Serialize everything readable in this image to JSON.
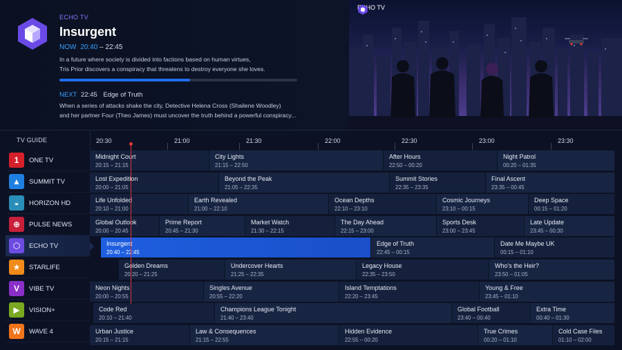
{
  "info": {
    "channel": "ECHO TV",
    "title": "Insurgent",
    "now_label": "NOW",
    "now_start": "20:40",
    "now_end": "– 22:45",
    "description_1": "In a future where society is divided into factions based on human virtues,",
    "description_2": "Tris Prior discovers a conspiracy that threatens to destroy everyone she loves.",
    "progress": 0.55,
    "next_label": "NEXT",
    "next_time": "22:45",
    "next_title": "Edge of Truth",
    "next_desc_1": "When a series of attacks shake the city, Detective Helena Cross (Shailene Woodley)",
    "next_desc_2": "and her partner Four (Theo James) must uncover the truth behind a powerful conspiracy..."
  },
  "preview": {
    "badge": "ECHO TV"
  },
  "guide": {
    "label": "TV GUIDE",
    "times": [
      "20:30",
      "21:00",
      "21:30",
      "22:00",
      "22:30",
      "23:00",
      "23:30"
    ],
    "channels": [
      {
        "name": "ONE TV",
        "glyph": "1",
        "color": "#d4202a"
      },
      {
        "name": "SUMMIT TV",
        "glyph": "▲",
        "color": "#1e7fe0"
      },
      {
        "name": "HORIZON HD",
        "glyph": "◒",
        "color": "#2a8fb8"
      },
      {
        "name": "PULSE NEWS",
        "glyph": "⊕",
        "color": "#c8203a"
      },
      {
        "name": "ECHO TV",
        "glyph": "⬡",
        "color": "#6b4be0"
      },
      {
        "name": "STARLIFE",
        "glyph": "★",
        "color": "#f08a1a"
      },
      {
        "name": "VIBE TV",
        "glyph": "V",
        "color": "#8a2fc8"
      },
      {
        "name": "VISION+",
        "glyph": "▶",
        "color": "#7aa820"
      },
      {
        "name": "WAVE 4",
        "glyph": "W",
        "color": "#f0741a"
      }
    ],
    "rows": [
      [
        {
          "title": "Midnight Court",
          "time": "20:15 – 21:15",
          "s": 0,
          "e": 173
        },
        {
          "title": "City Lights",
          "time": "21:15 – 22:50",
          "s": 173,
          "e": 425
        },
        {
          "title": "After Hours",
          "time": "22:50 – 00:20",
          "s": 425,
          "e": 590
        },
        {
          "title": "Night Patrol",
          "time": "00:20 – 01:35",
          "s": 590,
          "e": 760
        }
      ],
      [
        {
          "title": "Lost Expedition",
          "time": "20:00 – 21:05",
          "s": 0,
          "e": 187
        },
        {
          "title": "Beyond the Peak",
          "time": "21:05 – 22:35",
          "s": 187,
          "e": 434
        },
        {
          "title": "Summit Stories",
          "time": "22:35 – 23:35",
          "s": 434,
          "e": 573
        },
        {
          "title": "Final Ascent",
          "time": "23:35 – 00:45",
          "s": 573,
          "e": 760
        }
      ],
      [
        {
          "title": "Life Unfolded",
          "time": "20:10 – 21:00",
          "s": 0,
          "e": 143
        },
        {
          "title": "Earth Revealed",
          "time": "21:00 – 22:10",
          "s": 143,
          "e": 346
        },
        {
          "title": "Ocean Depths",
          "time": "22:10 – 23:10",
          "s": 346,
          "e": 502
        },
        {
          "title": "Cosmic Journeys",
          "time": "23:10 – 00:15",
          "s": 502,
          "e": 635
        },
        {
          "title": "Deep Space",
          "time": "00:15 – 01:20",
          "s": 635,
          "e": 760
        }
      ],
      [
        {
          "title": "Global Outlook",
          "time": "20:00 – 20:45",
          "s": 0,
          "e": 101
        },
        {
          "title": "Prime Report",
          "time": "20:45 – 21:30",
          "s": 101,
          "e": 225
        },
        {
          "title": "Market Watch",
          "time": "21:30 – 22:15",
          "s": 225,
          "e": 355
        },
        {
          "title": "The Day Ahead",
          "time": "22:15 – 23:00",
          "s": 355,
          "e": 502
        },
        {
          "title": "Sports Desk",
          "time": "23:00 – 23:45",
          "s": 502,
          "e": 629
        },
        {
          "title": "Late Update",
          "time": "23:45 – 00:30",
          "s": 629,
          "e": 760
        }
      ],
      [
        {
          "title": "Insurgent",
          "time": "20:40 – 22:45",
          "s": 16,
          "e": 407,
          "on": true
        },
        {
          "title": "Edge of Truth",
          "time": "22:45 – 00:15",
          "s": 407,
          "e": 586
        },
        {
          "title": "Date Me Maybe UK",
          "time": "00:15 – 01:10",
          "s": 586,
          "e": 760
        }
      ],
      [
        {
          "title": "Golden Dreams",
          "time": "20:20 – 21:25",
          "s": 42,
          "e": 196
        },
        {
          "title": "Undercover Hearts",
          "time": "21:25 – 22:35",
          "s": 196,
          "e": 386
        },
        {
          "title": "Legacy House",
          "time": "22:35 – 23:50",
          "s": 386,
          "e": 578
        },
        {
          "title": "Who's the Heir?",
          "time": "23:50 – 01:05",
          "s": 578,
          "e": 760
        }
      ],
      [
        {
          "title": "Neon Nights",
          "time": "20:00 – 20:55",
          "s": 0,
          "e": 165
        },
        {
          "title": "Singles Avenue",
          "time": "20:55 – 22:20",
          "s": 165,
          "e": 361
        },
        {
          "title": "Island Temptations",
          "time": "22:20 – 23:45",
          "s": 361,
          "e": 564
        },
        {
          "title": "Young & Free",
          "time": "23:45 – 01:10",
          "s": 564,
          "e": 760
        }
      ],
      [
        {
          "title": "Code Red",
          "time": "20:10 – 21:40",
          "s": 5,
          "e": 181
        },
        {
          "title": "Champions League Tonight",
          "time": "21:40 – 23:40",
          "s": 181,
          "e": 524
        },
        {
          "title": "Global Football",
          "time": "23:40 – 00:40",
          "s": 524,
          "e": 638
        },
        {
          "title": "Extra Time",
          "time": "00:40 – 01:30",
          "s": 638,
          "e": 760
        }
      ],
      [
        {
          "title": "Urban Justice",
          "time": "20:15 – 21:15",
          "s": 0,
          "e": 145
        },
        {
          "title": "Law & Consequences",
          "time": "21:15 – 22:55",
          "s": 145,
          "e": 361
        },
        {
          "title": "Hidden Evidence",
          "time": "22:55 – 00:20",
          "s": 361,
          "e": 562
        },
        {
          "title": "True Crimes",
          "time": "00:20 – 01:10",
          "s": 562,
          "e": 670
        },
        {
          "title": "Cold Case Files",
          "time": "01:10 – 02:00",
          "s": 670,
          "e": 760
        }
      ]
    ]
  }
}
